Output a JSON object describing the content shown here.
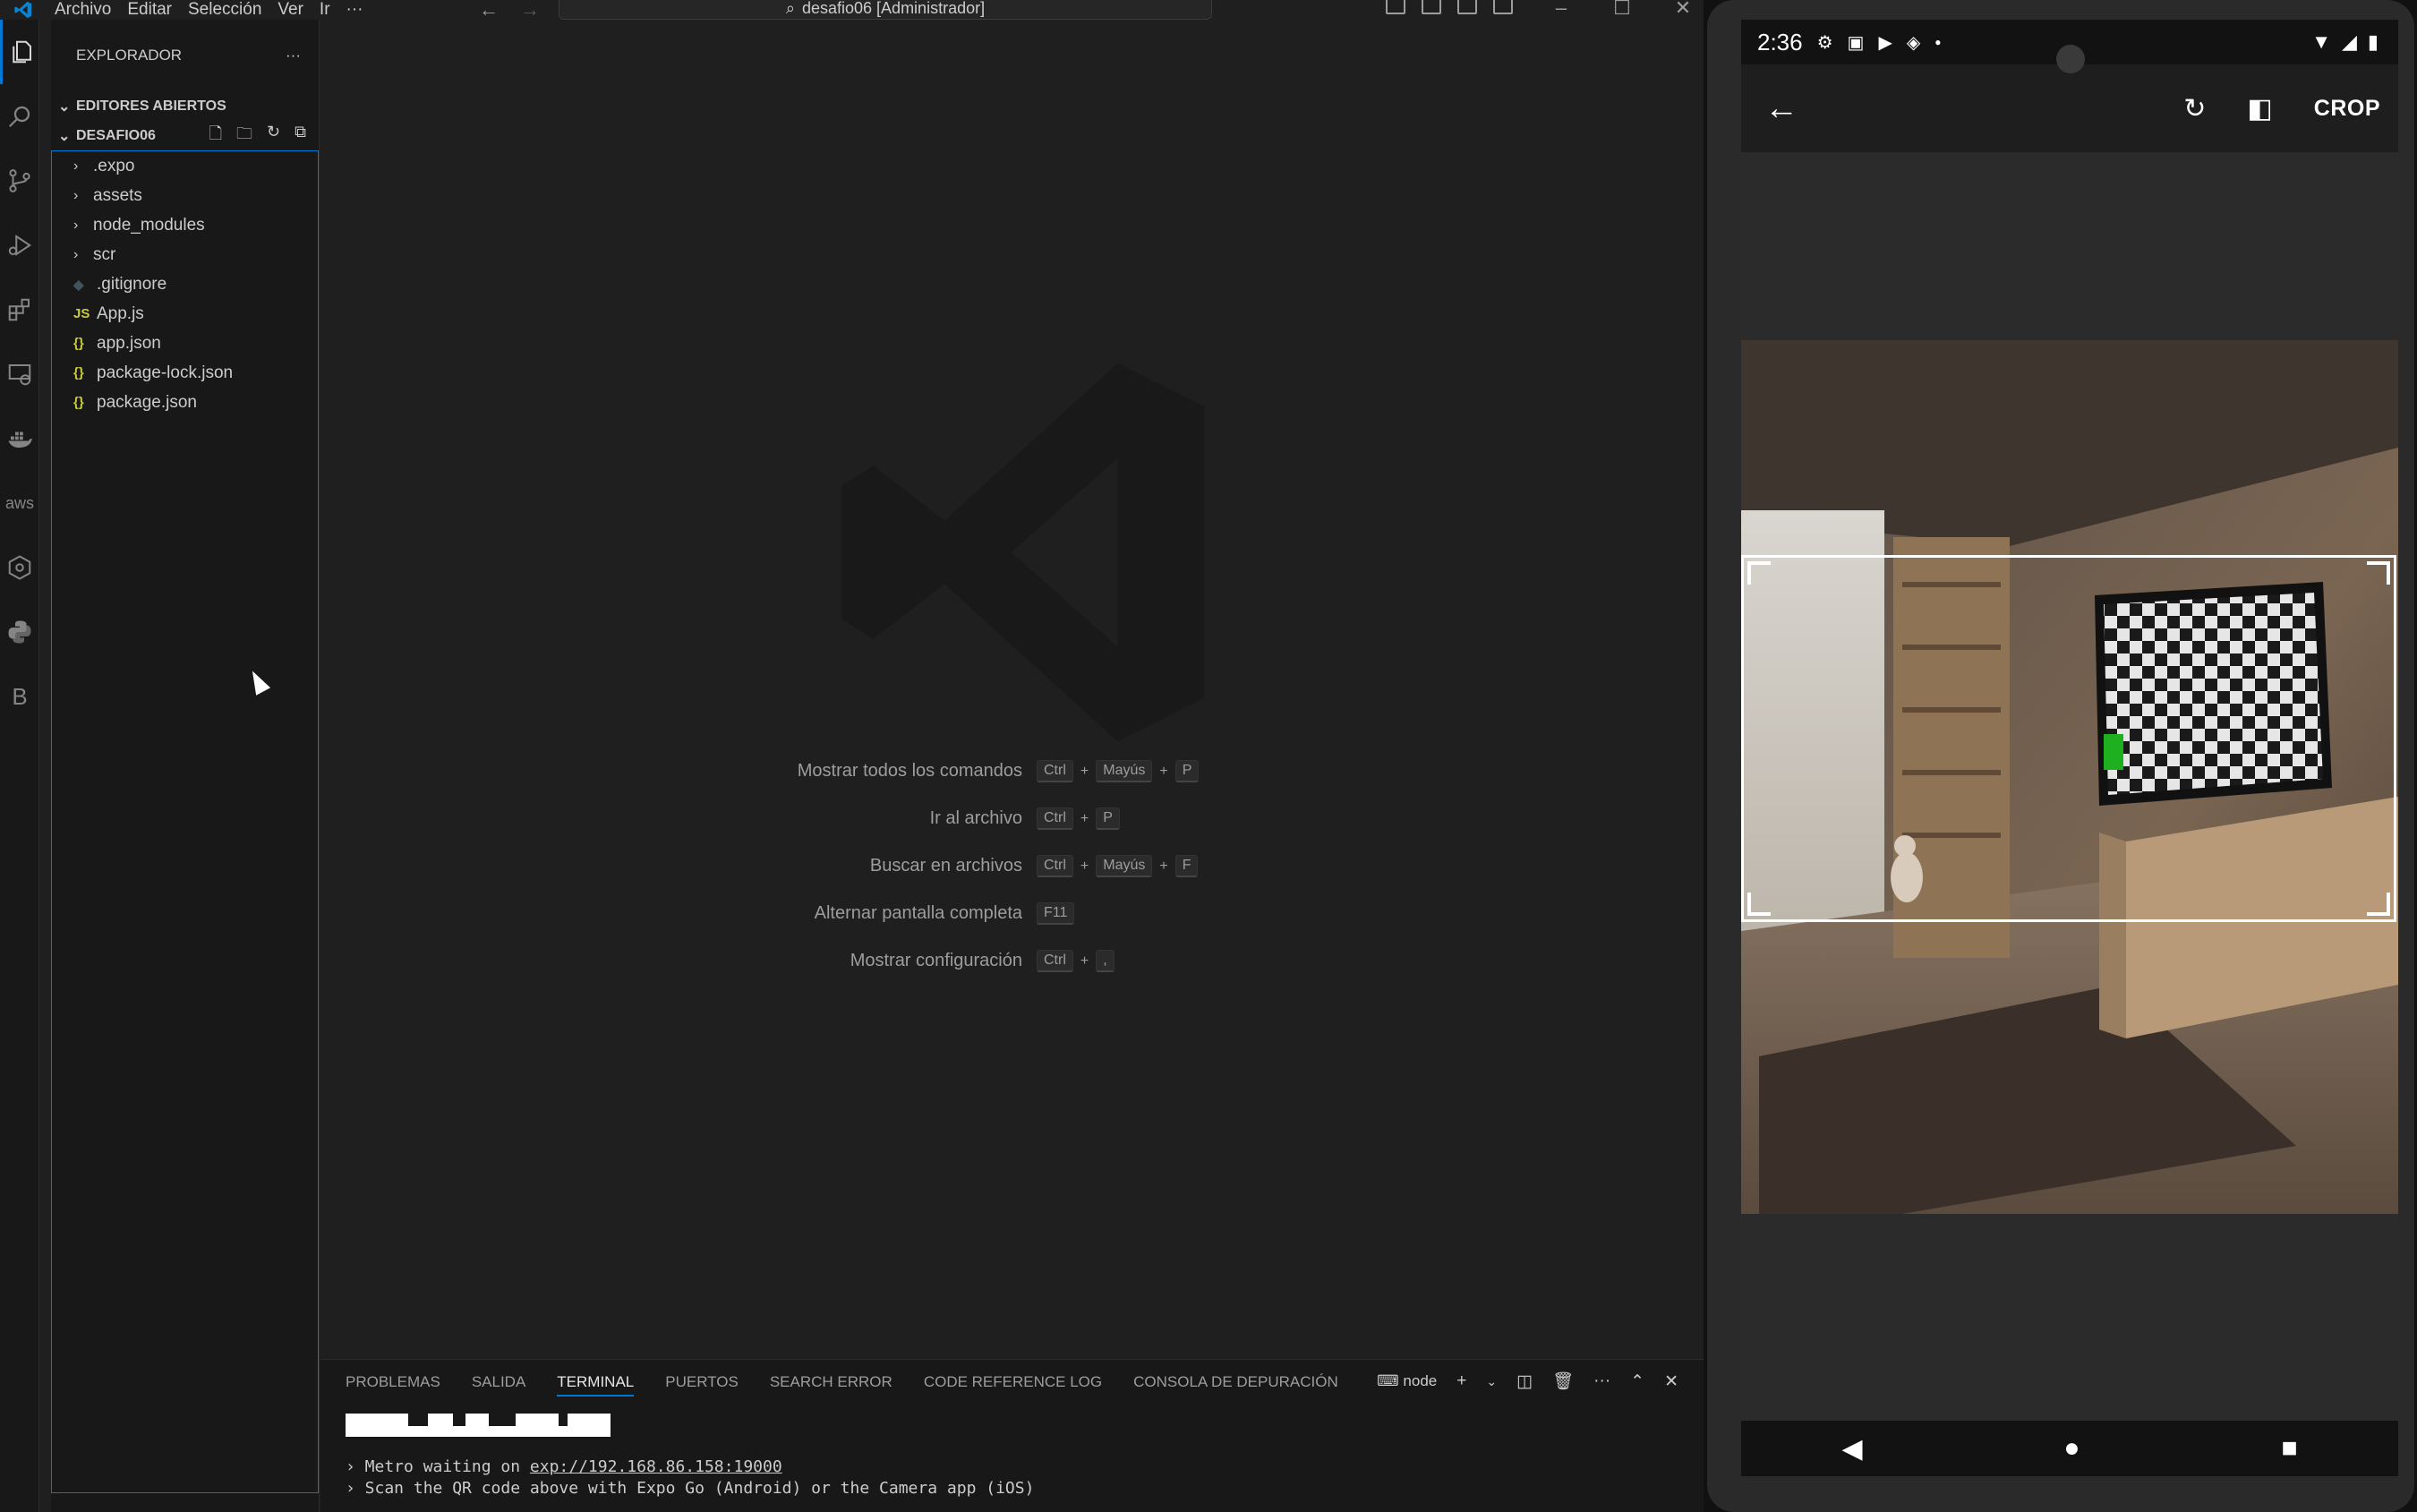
{
  "titlebar": {
    "menu": [
      "Archivo",
      "Editar",
      "Selección",
      "Ver",
      "Ir",
      "···"
    ],
    "search_text": "desafio06 [Administrador]"
  },
  "activitybar": {
    "icons": [
      "explorer-icon",
      "search-icon",
      "source-control-icon",
      "run-debug-icon",
      "extensions-icon",
      "remote-explorer-icon",
      "docker-icon",
      "aws-icon",
      "kubernetes-icon",
      "python-icon",
      "b-icon"
    ],
    "aws_label": "aws",
    "b_label": "B"
  },
  "sidebar": {
    "title": "EXPLORADOR",
    "more": "···",
    "open_editors": "EDITORES ABIERTOS",
    "project": "DESAFIO06",
    "tree": [
      {
        "name": ".expo",
        "kind": "folder"
      },
      {
        "name": "assets",
        "kind": "folder"
      },
      {
        "name": "node_modules",
        "kind": "folder"
      },
      {
        "name": "scr",
        "kind": "folder"
      },
      {
        "name": ".gitignore",
        "kind": "git"
      },
      {
        "name": "App.js",
        "kind": "js"
      },
      {
        "name": "app.json",
        "kind": "json"
      },
      {
        "name": "package-lock.json",
        "kind": "json"
      },
      {
        "name": "package.json",
        "kind": "json"
      }
    ]
  },
  "editor": {
    "shortcuts": [
      {
        "label": "Mostrar todos los comandos",
        "keys": [
          "Ctrl",
          "Mayús",
          "P"
        ]
      },
      {
        "label": "Ir al archivo",
        "keys": [
          "Ctrl",
          "P"
        ]
      },
      {
        "label": "Buscar en archivos",
        "keys": [
          "Ctrl",
          "Mayús",
          "F"
        ]
      },
      {
        "label": "Alternar pantalla completa",
        "keys": [
          "F11"
        ]
      },
      {
        "label": "Mostrar configuración",
        "keys": [
          "Ctrl",
          ","
        ]
      }
    ]
  },
  "panel": {
    "tabs": [
      "PROBLEMAS",
      "SALIDA",
      "TERMINAL",
      "PUERTOS",
      "SEARCH ERROR",
      "CODE REFERENCE LOG",
      "CONSOLA DE DEPURACIÓN"
    ],
    "active_tab": "TERMINAL",
    "shell": "node",
    "terminal": {
      "line1_prefix": "› Metro waiting on ",
      "line1_link": "exp://192.168.86.158:19000",
      "line2": "› Scan the QR code above with Expo Go (Android) or the Camera app (iOS)"
    }
  },
  "phone": {
    "time": "2:36",
    "crop_label": "CROP"
  }
}
